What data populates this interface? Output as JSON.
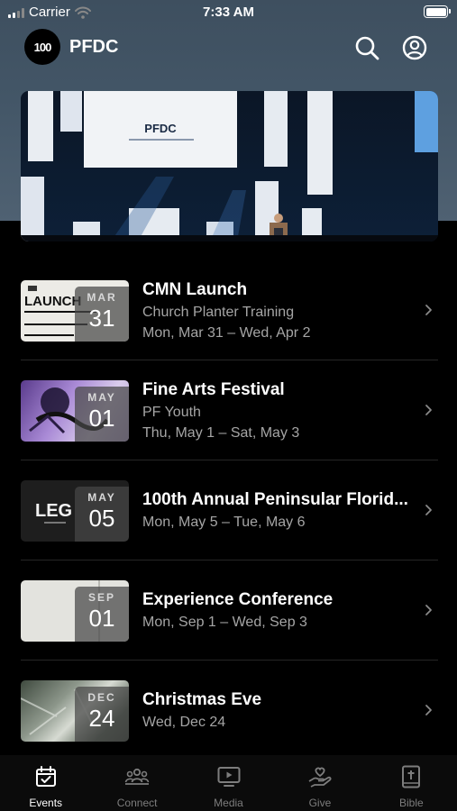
{
  "status_bar": {
    "carrier": "Carrier",
    "time": "7:33 AM"
  },
  "header": {
    "logo_text": "100",
    "title": "PFDC"
  },
  "hero": {
    "screen_text": "PFDC"
  },
  "events": [
    {
      "title": "CMN Launch",
      "subtitle": "Church Planter Training",
      "dates": "Mon, Mar 31 – Wed, Apr 2",
      "month": "MAR",
      "day": "31",
      "thumb_text": "LAUNCH"
    },
    {
      "title": "Fine Arts Festival",
      "subtitle": "PF Youth",
      "dates": "Thu, May 1 – Sat, May 3",
      "month": "MAY",
      "day": "01"
    },
    {
      "title": "100th Annual Peninsular Florid...",
      "subtitle": "",
      "dates": "Mon, May 5 – Tue, May 6",
      "month": "MAY",
      "day": "05",
      "thumb_text": "LEG"
    },
    {
      "title": "Experience Conference",
      "subtitle": "",
      "dates": "Mon, Sep 1 – Wed, Sep 3",
      "month": "SEP",
      "day": "01"
    },
    {
      "title": "Christmas Eve",
      "subtitle": "",
      "dates": "Wed, Dec 24",
      "month": "DEC",
      "day": "24"
    }
  ],
  "tabs": [
    {
      "label": "Events",
      "icon": "calendar-icon",
      "active": true
    },
    {
      "label": "Connect",
      "icon": "people-icon",
      "active": false
    },
    {
      "label": "Media",
      "icon": "play-screen-icon",
      "active": false
    },
    {
      "label": "Give",
      "icon": "hand-heart-icon",
      "active": false
    },
    {
      "label": "Bible",
      "icon": "bible-icon",
      "active": false
    }
  ],
  "colors": {
    "background": "#000000",
    "header_bg": "#435667",
    "secondary_text": "#a5a5a5",
    "tab_inactive": "#7d7d7d"
  }
}
